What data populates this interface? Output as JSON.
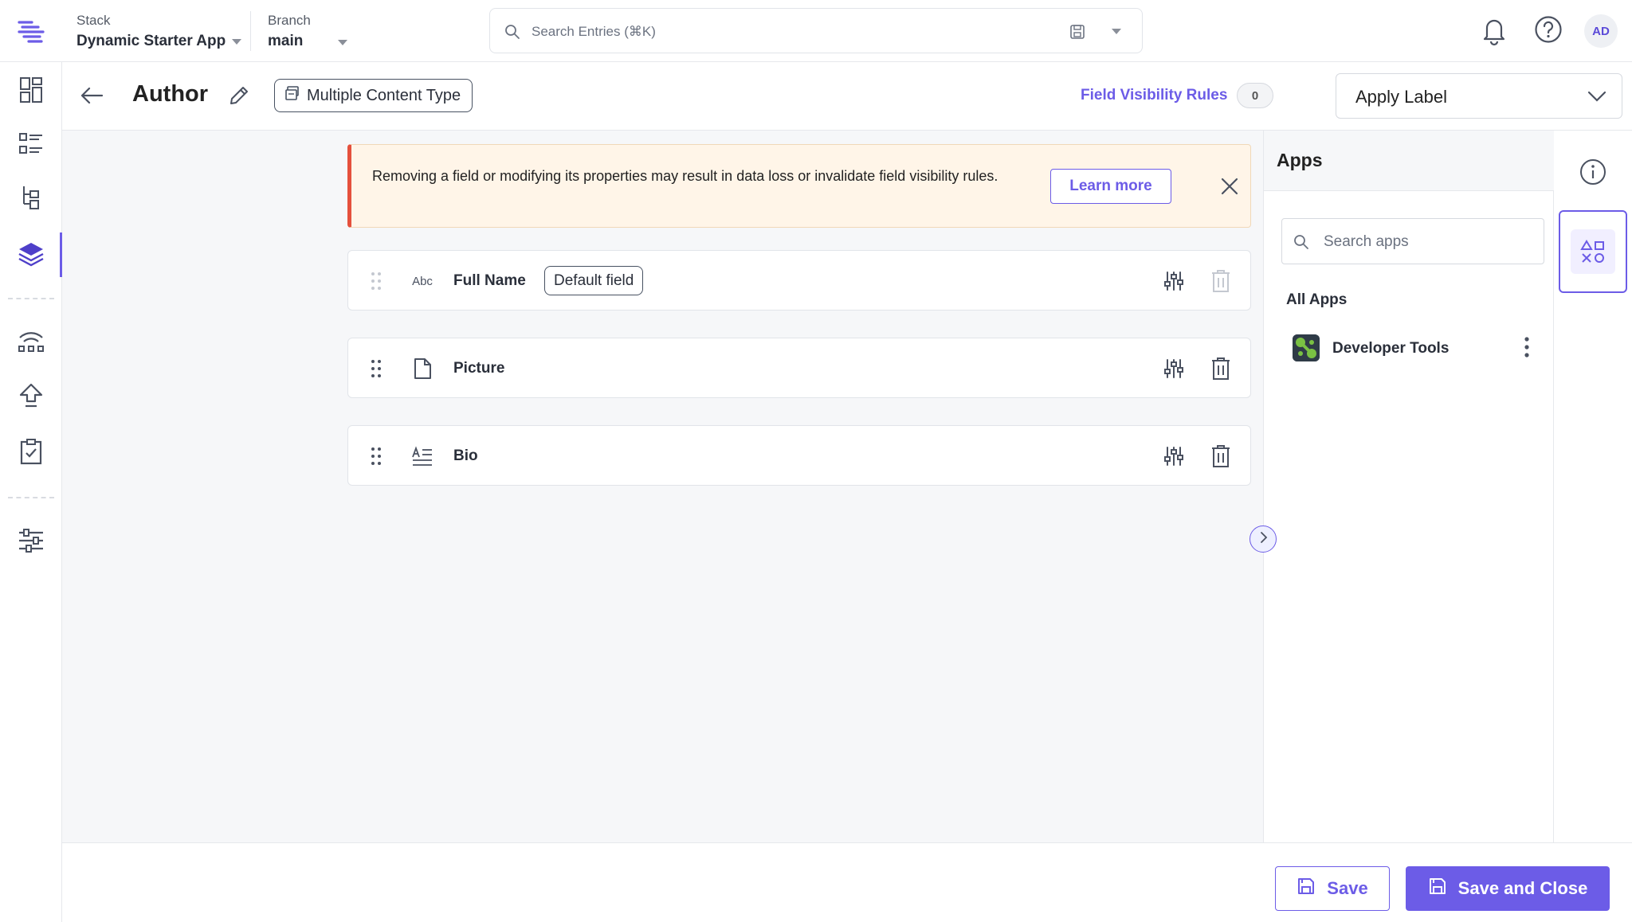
{
  "topbar": {
    "stack_label": "Stack",
    "stack_value": "Dynamic Starter App",
    "branch_label": "Branch",
    "branch_value": "main",
    "search_placeholder": "Search Entries (⌘K)",
    "avatar_initials": "AD"
  },
  "header": {
    "title": "Author",
    "content_type_badge": "Multiple Content Type",
    "field_visibility_label": "Field Visibility Rules",
    "field_visibility_count": "0",
    "apply_label": "Apply Label"
  },
  "notice": {
    "message": "Removing a field or modifying its properties may result in data loss or invalidate field visibility rules.",
    "learn_more": "Learn more"
  },
  "fields": [
    {
      "name": "Full Name",
      "type_icon": "abc-text-icon",
      "badge": "Default field"
    },
    {
      "name": "Picture",
      "type_icon": "file-icon",
      "badge": ""
    },
    {
      "name": "Bio",
      "type_icon": "multiline-text-icon",
      "badge": ""
    }
  ],
  "field_type_glyphs": {
    "abc": "Abc"
  },
  "apps_panel": {
    "title": "Apps",
    "search_placeholder": "Search apps",
    "section_title": "All Apps",
    "apps": [
      {
        "name": "Developer Tools",
        "icon": "developer-tools-app-icon"
      }
    ]
  },
  "footer": {
    "save": "Save",
    "save_and_close": "Save and Close"
  },
  "colors": {
    "accent": "#6c5ce7",
    "warning_bg": "#fff5e8",
    "warning_border": "#e5503c"
  }
}
